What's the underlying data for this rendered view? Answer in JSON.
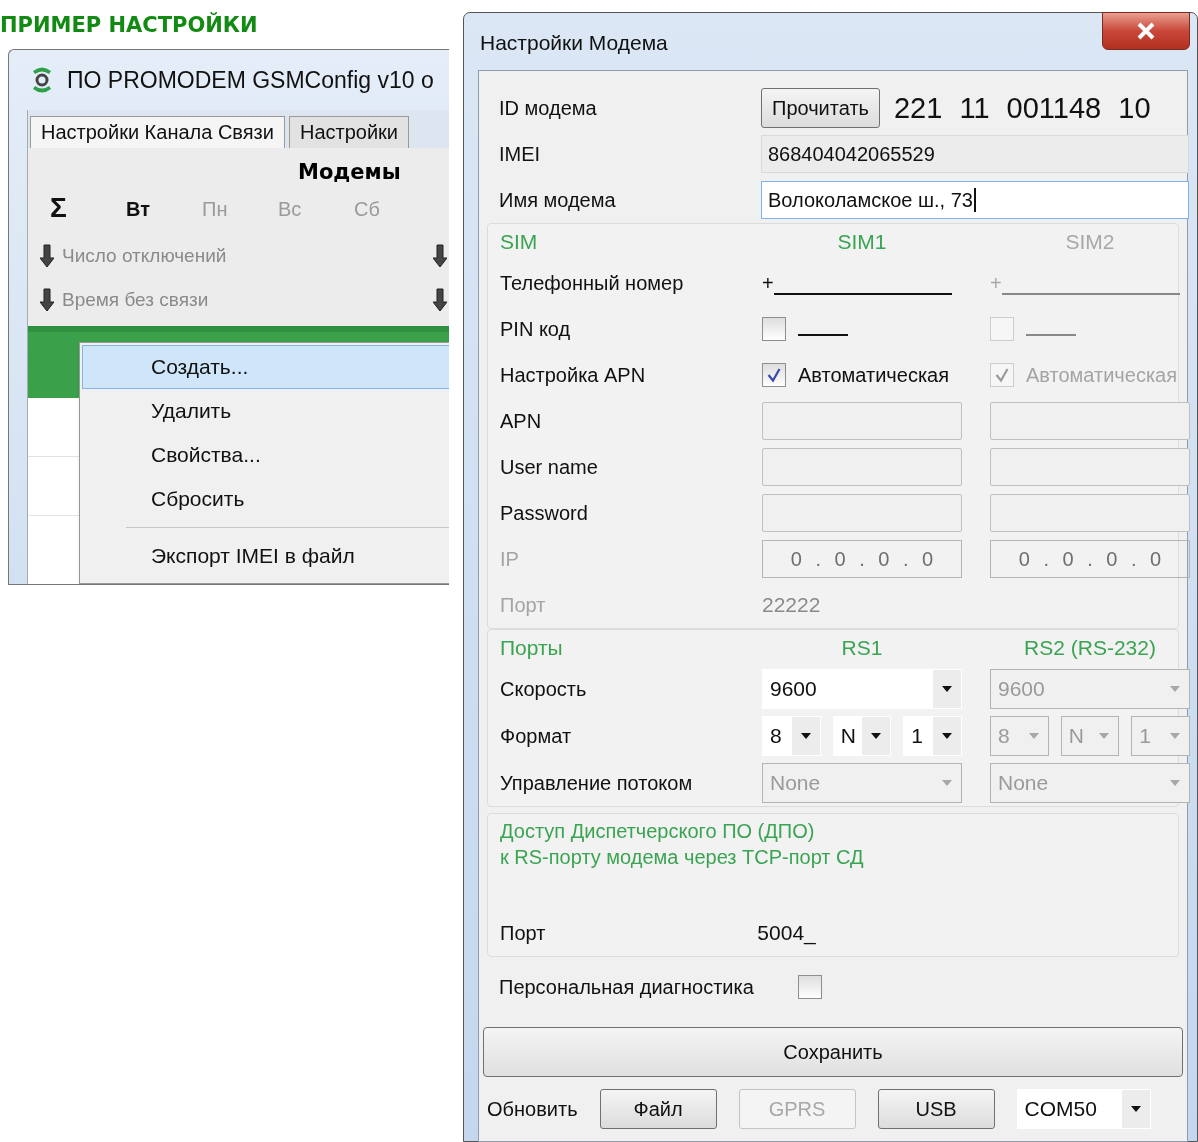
{
  "heading": "ПРИМЕР НАСТРОЙКИ",
  "app": {
    "title": "ПО PROMODEM GSMConfig v10 о",
    "tabs": [
      {
        "label": "Настройки Канала Связи",
        "selected": true
      },
      {
        "label": "Настройки",
        "selected": false
      }
    ],
    "section_title": "Модемы",
    "days": [
      {
        "label": "Σ",
        "kind": "total"
      },
      {
        "label": "Вт",
        "kind": "day",
        "selected": true
      },
      {
        "label": "Пн",
        "kind": "day",
        "selected": false
      },
      {
        "label": "Вс",
        "kind": "day",
        "selected": false
      },
      {
        "label": "Сб",
        "kind": "day",
        "selected": false
      }
    ],
    "sort_items": [
      {
        "label": "Число отключений"
      },
      {
        "label": "Время без связи"
      }
    ],
    "context_menu": [
      {
        "label": "Создать...",
        "selected": true,
        "separator_before": false
      },
      {
        "label": "Удалить",
        "selected": false,
        "separator_before": false
      },
      {
        "label": "Свойства...",
        "selected": false,
        "separator_before": false
      },
      {
        "label": "Сбросить",
        "selected": false,
        "separator_before": false
      },
      {
        "label": "Экспорт IMEI в файл",
        "selected": false,
        "separator_before": true
      }
    ]
  },
  "dialog": {
    "title": "Настройки Модема",
    "id": {
      "label": "ID модема",
      "button": "Прочитать",
      "value": "221 11 001148 10"
    },
    "imei": {
      "label": "IMEI",
      "value": "868404042065529",
      "disabled": true
    },
    "name": {
      "label": "Имя модема",
      "value": "Волоколамское ш., 73",
      "focused": true
    },
    "sim_group": {
      "legend": "SIM",
      "columns": [
        {
          "label": "SIM1",
          "disabled": false
        },
        {
          "label": "SIM2",
          "disabled": true
        }
      ],
      "rows": [
        {
          "kind": "mask",
          "label": "Телефонный номер",
          "disabled": false,
          "cells": [
            {
              "prefix": "+",
              "disabled": false
            },
            {
              "prefix": "+",
              "disabled": true
            }
          ]
        },
        {
          "kind": "checkbox_mask",
          "label": "PIN код",
          "disabled": false,
          "cells": [
            {
              "checked": false,
              "disabled": false
            },
            {
              "checked": false,
              "disabled": true
            }
          ]
        },
        {
          "kind": "checkbox",
          "label": "Настройка APN",
          "disabled": false,
          "cells": [
            {
              "checked": true,
              "label": "Автоматическая",
              "disabled": false
            },
            {
              "checked": true,
              "label": "Автоматическая",
              "disabled": true
            }
          ]
        },
        {
          "kind": "text",
          "label": "APN",
          "disabled": false,
          "cells": [
            {
              "disabled": true
            },
            {
              "disabled": true
            }
          ]
        },
        {
          "kind": "text",
          "label": "User name",
          "disabled": false,
          "cells": [
            {
              "disabled": true
            },
            {
              "disabled": true
            }
          ]
        },
        {
          "kind": "text",
          "label": "Password",
          "disabled": false,
          "cells": [
            {
              "disabled": true
            },
            {
              "disabled": true
            }
          ]
        },
        {
          "kind": "ip",
          "label": "IP",
          "disabled": true,
          "cells": [
            {
              "value": "0 . 0 . 0 . 0",
              "disabled": true
            },
            {
              "value": "0 . 0 . 0 . 0",
              "disabled": true
            }
          ]
        },
        {
          "kind": "value",
          "label": "Порт",
          "disabled": true,
          "cells": [
            {
              "value": "22222",
              "disabled": true
            }
          ]
        }
      ]
    },
    "ports_group": {
      "legend": "Порты",
      "columns": [
        {
          "label": "RS1",
          "disabled": false
        },
        {
          "label": "RS2 (RS-232)",
          "disabled": false
        }
      ],
      "rows": [
        {
          "kind": "select",
          "label": "Скорость",
          "disabled": false,
          "cells": [
            {
              "value": "9600",
              "disabled": false
            },
            {
              "value": "9600",
              "disabled": true
            }
          ]
        },
        {
          "kind": "format",
          "label": "Формат",
          "disabled": false,
          "cells": [
            {
              "parts": [
                "8",
                "N",
                "1"
              ],
              "disabled": false
            },
            {
              "parts": [
                "8",
                "N",
                "1"
              ],
              "disabled": true
            }
          ]
        },
        {
          "kind": "select",
          "label": "Управление потоком",
          "disabled": false,
          "cells": [
            {
              "value": "None",
              "disabled": true
            },
            {
              "value": "None",
              "disabled": true
            }
          ]
        }
      ]
    },
    "dpo_group": {
      "legend_lines": [
        "Доступ Диспетчерского ПО (ДПО)",
        "к RS-порту модема через TCP-порт СД"
      ],
      "port_label": "Порт",
      "port_value": "5004_"
    },
    "diagnostics": {
      "label": "Персональная диагностика",
      "checked": false
    },
    "save_button": "Сохранить",
    "footer": {
      "label": "Обновить",
      "buttons": [
        {
          "label": "Файл",
          "disabled": false
        },
        {
          "label": "GPRS",
          "disabled": true
        },
        {
          "label": "USB",
          "disabled": false
        }
      ],
      "port_select": "COM50"
    }
  }
}
